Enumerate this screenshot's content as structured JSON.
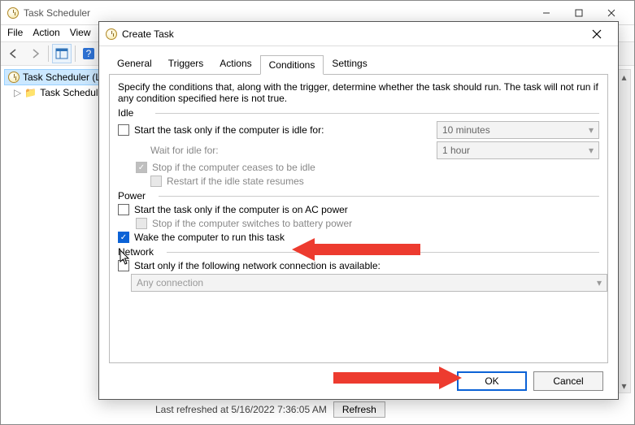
{
  "mainWindow": {
    "title": "Task Scheduler",
    "menu": {
      "file": "File",
      "action": "Action",
      "view": "View"
    },
    "tree": {
      "root": "Task Scheduler (L",
      "child": "Task Schedul"
    },
    "status": {
      "text": "Last refreshed at 5/16/2022 7:36:05 AM",
      "refresh": "Refresh"
    }
  },
  "dialog": {
    "title": "Create Task",
    "tabs": {
      "general": "General",
      "triggers": "Triggers",
      "actions": "Actions",
      "conditions": "Conditions",
      "settings": "Settings"
    },
    "description": "Specify the conditions that, along with the trigger, determine whether the task should run.  The task will not run  if any condition specified here is not true.",
    "idle": {
      "label": "Idle",
      "startOnlyIdle": "Start the task only if the computer is idle for:",
      "idleDuration": "10 minutes",
      "waitLabel": "Wait for idle for:",
      "waitDuration": "1 hour",
      "stopIfCeases": "Stop if the computer ceases to be idle",
      "restartIfResumes": "Restart if the idle state resumes"
    },
    "power": {
      "label": "Power",
      "acPower": "Start the task only if the computer is on AC power",
      "stopBattery": "Stop if the computer switches to battery power",
      "wake": "Wake the computer to run this task"
    },
    "network": {
      "label": "Network",
      "startOnlyNet": "Start only if the following network connection is available:",
      "anyConnection": "Any connection"
    },
    "buttons": {
      "ok": "OK",
      "cancel": "Cancel"
    }
  }
}
